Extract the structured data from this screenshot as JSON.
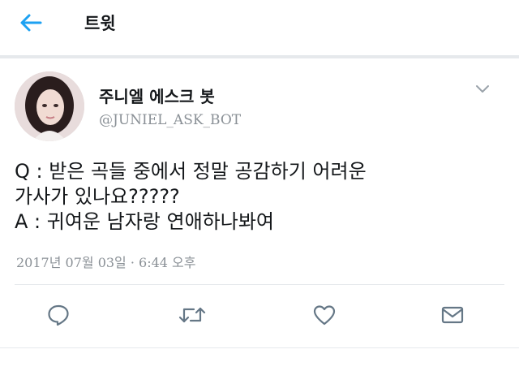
{
  "header": {
    "title": "트윗",
    "back_icon": "arrow-left-icon"
  },
  "colors": {
    "accent": "#1da1f2",
    "text_primary": "#14171a",
    "text_secondary": "#8a9096",
    "divider": "#e6e9ec"
  },
  "tweet": {
    "author": {
      "display_name": "주니엘 에스크 봇",
      "handle": "@JUNIEL_ASK_BOT"
    },
    "lines": [
      "Q : 받은 곡들 중에서 정말 공감하기 어려운",
      "가사가 있나요?????",
      "A : 귀여운 남자랑 연애하나봐여"
    ],
    "timestamp": "2017년 07월 03일 · 6:44 오후"
  },
  "actions": [
    {
      "name": "reply",
      "icon": "reply-icon"
    },
    {
      "name": "retweet",
      "icon": "retweet-icon"
    },
    {
      "name": "like",
      "icon": "heart-icon"
    },
    {
      "name": "message",
      "icon": "mail-icon"
    }
  ]
}
